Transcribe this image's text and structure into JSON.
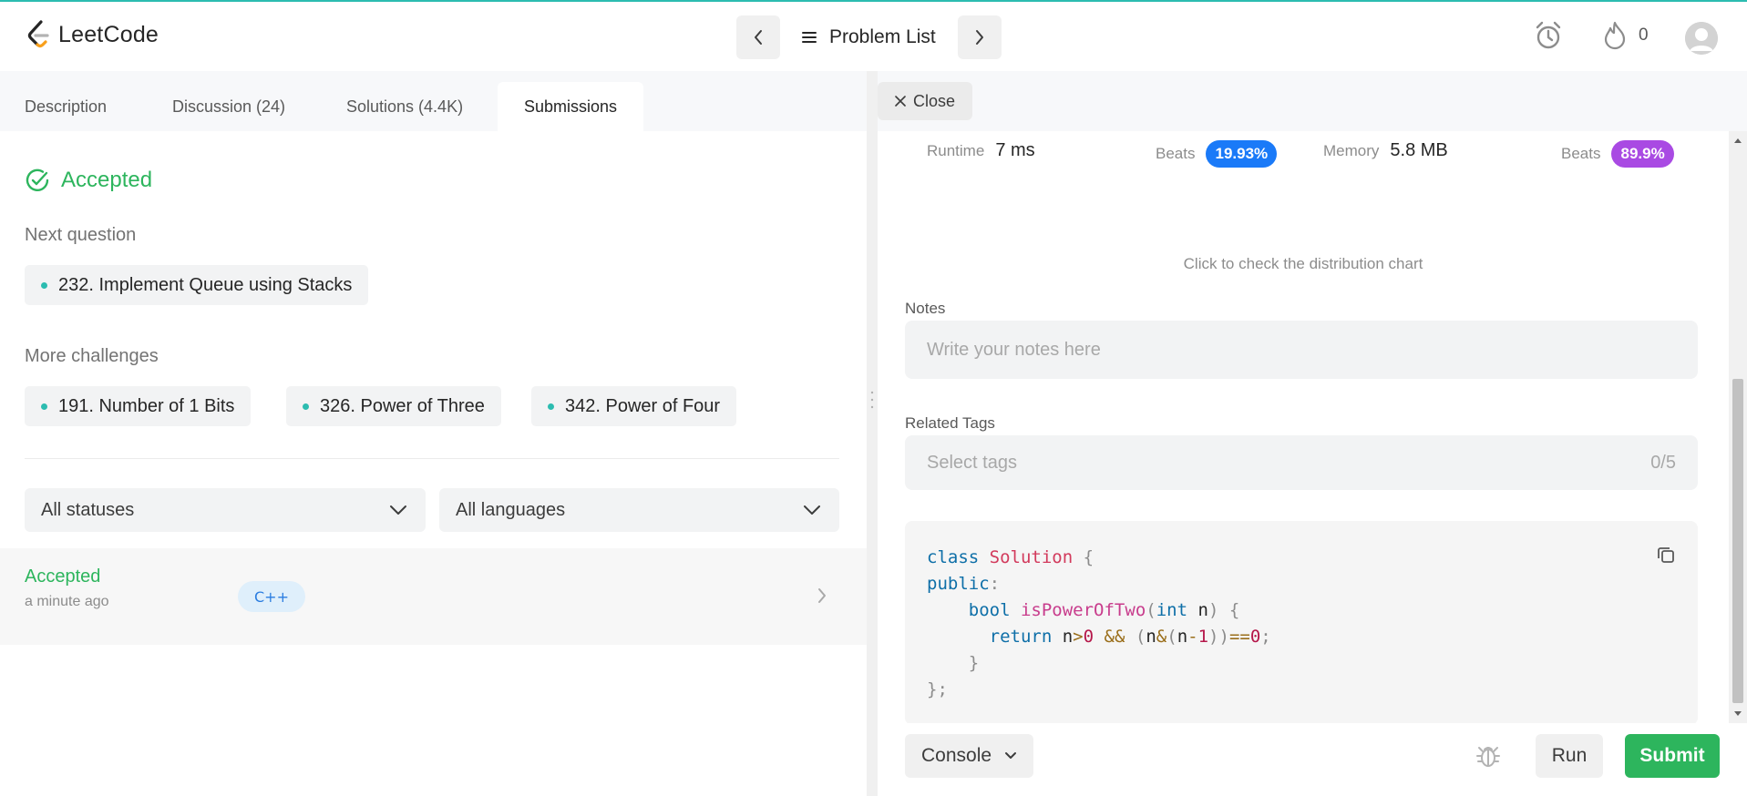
{
  "header": {
    "logo_text": "LeetCode",
    "problem_list_label": "Problem List",
    "streak_count": "0"
  },
  "left": {
    "tabs": [
      {
        "label": "Description"
      },
      {
        "label": "Discussion (24)"
      },
      {
        "label": "Solutions (4.4K)"
      },
      {
        "label": "Submissions"
      }
    ],
    "result": "Accepted",
    "next_question_label": "Next question",
    "next_question": "232. Implement Queue using Stacks",
    "more_challenges_label": "More challenges",
    "challenges": [
      "191. Number of 1 Bits",
      "326. Power of Three",
      "342. Power of Four"
    ],
    "status_filter": "All statuses",
    "language_filter": "All languages",
    "submission": {
      "status": "Accepted",
      "time": "a minute ago",
      "language": "C++"
    }
  },
  "right": {
    "close_label": "Close",
    "runtime_label": "Runtime",
    "runtime_value": "7 ms",
    "runtime_beats_label": "Beats",
    "runtime_beats": "19.93%",
    "memory_label": "Memory",
    "memory_value": "5.8 MB",
    "memory_beats_label": "Beats",
    "memory_beats": "89.9%",
    "distribution_link": "Click to check the distribution chart",
    "notes_label": "Notes",
    "notes_placeholder": "Write your notes here",
    "tags_label": "Related Tags",
    "tags_placeholder": "Select tags",
    "tags_count": "0/5",
    "console_label": "Console",
    "run_label": "Run",
    "submit_label": "Submit"
  },
  "colors": {
    "accent_green": "#2db55d",
    "runtime_badge": "#1a7af8",
    "memory_badge": "#a94ae3",
    "teal": "#2cbcb0"
  },
  "code": {
    "language": "C++",
    "lines": [
      "class Solution {",
      "public:",
      "    bool isPowerOfTwo(int n) {",
      "      return n>0 && (n&(n-1))==0;",
      "    }",
      "};"
    ]
  }
}
